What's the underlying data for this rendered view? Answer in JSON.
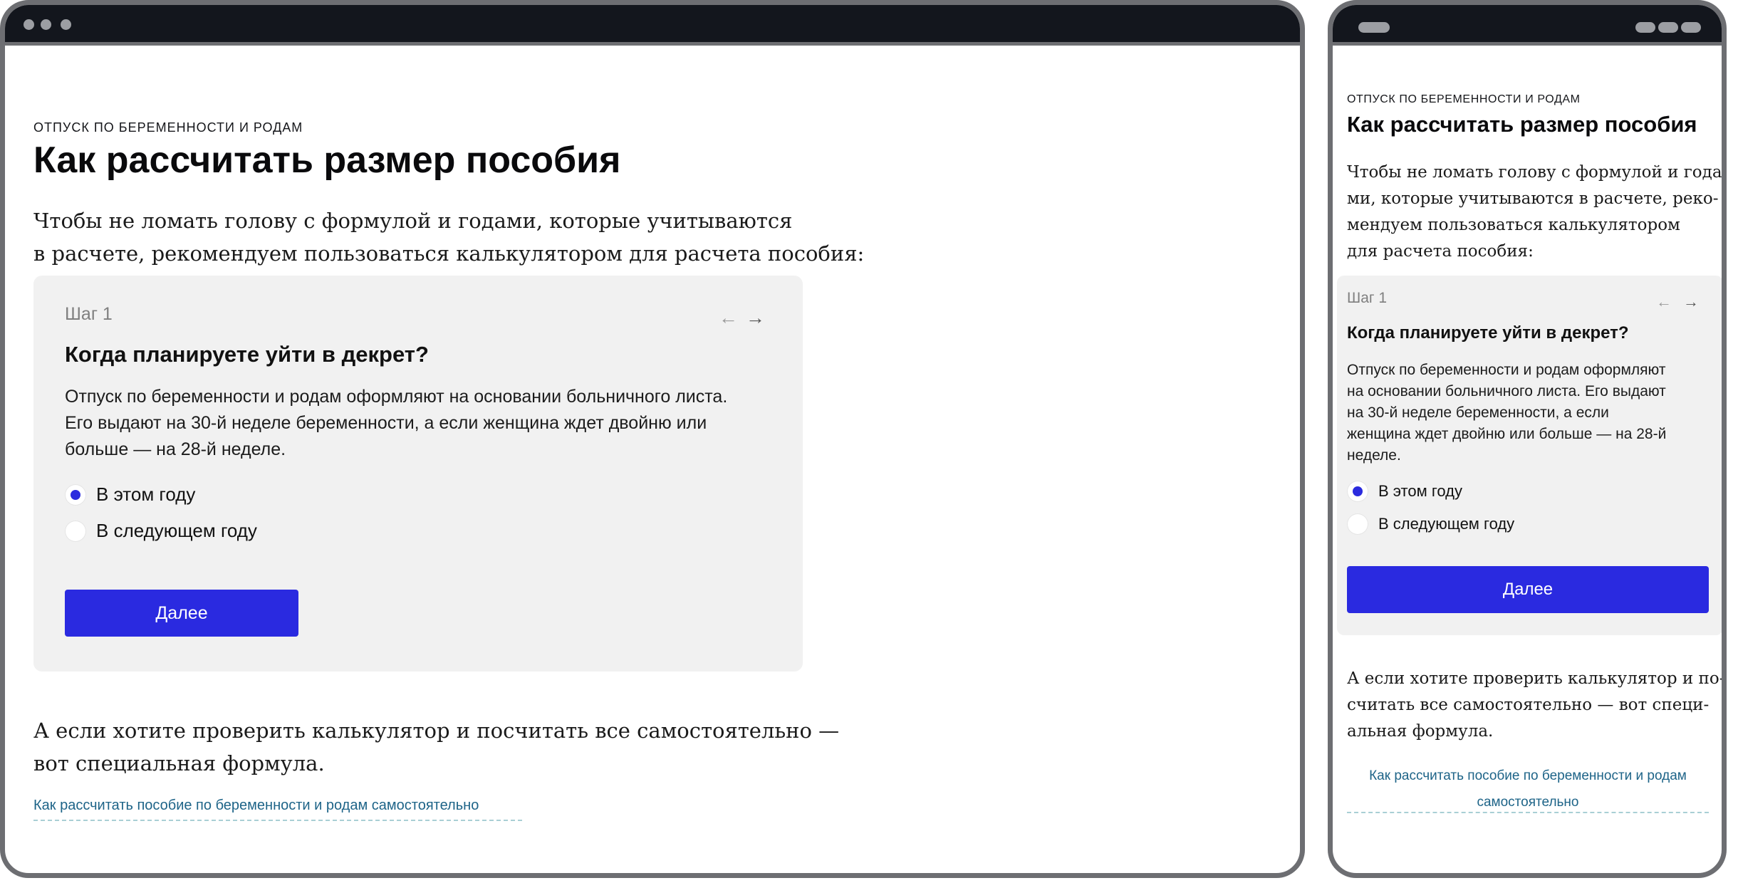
{
  "article": {
    "eyebrow": "Отпуск по беременности и родам",
    "title": "Как рассчитать размер пособия",
    "intro_desktop_l1": "Чтобы не ломать голову с формулой и годами, которые учитываются",
    "intro_desktop_l2": "в расчете, рекомендуем пользоваться калькулятором для расчета пособия:",
    "intro_mobile_l1": "Чтобы не ломать голову с формулой и года-",
    "intro_mobile_l2": "ми, которые учитываются в расчете, реко-",
    "intro_mobile_l3": "мендуем пользоваться калькулятором",
    "intro_mobile_l4": "для расчета пособия:",
    "outro_desktop_l1": "А если хотите проверить калькулятор и посчитать все самостоятельно —",
    "outro_desktop_l2": "вот специальная формула.",
    "outro_mobile_l1": "А если хотите проверить калькулятор и по-",
    "outro_mobile_l2": "считать все самостоятельно — вот специ-",
    "outro_mobile_l3": "альная формула.",
    "link_text": "Как рассчитать пособие по беременности и родам самостоятельно",
    "link_mobile_l1": "Как рассчитать пособие по беременности и родам",
    "link_mobile_l2": "самостоятельно"
  },
  "calculator": {
    "step": "Шаг 1",
    "question": "Когда планируете уйти в декрет?",
    "desc_desktop_l1": "Отпуск по беременности и родам оформляют на основании больничного листа.",
    "desc_desktop_l2": "Его выдают на 30-й неделе беременности, а если женщина ждет двойню или",
    "desc_desktop_l3": "больше — на 28-й неделе.",
    "desc_mobile_l1": "Отпуск по беременности и родам оформляют",
    "desc_mobile_l2": "на основании больничного листа. Его выдают",
    "desc_mobile_l3": "на 30-й неделе беременности, а если",
    "desc_mobile_l4": "женщина ждет двойню или больше — на 28-й",
    "desc_mobile_l5": "неделе.",
    "options": [
      {
        "label": "В этом году",
        "checked": true
      },
      {
        "label": "В следующем году",
        "checked": false
      }
    ],
    "prev_arrow": "←",
    "next_arrow": "→",
    "next_button": "Далее"
  },
  "icons": {
    "prev": "arrow-left-icon",
    "next": "arrow-right-icon"
  },
  "colors": {
    "accent": "#2a2ae0",
    "link": "#1e6488",
    "card_bg": "#f1f1f1",
    "frame": "#6d6e72",
    "topbar": "#13161d"
  }
}
